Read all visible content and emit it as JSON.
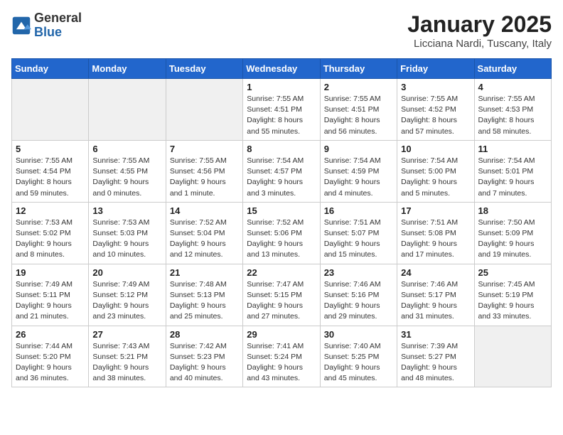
{
  "header": {
    "logo_general": "General",
    "logo_blue": "Blue",
    "month_title": "January 2025",
    "location": "Licciana Nardi, Tuscany, Italy"
  },
  "days_of_week": [
    "Sunday",
    "Monday",
    "Tuesday",
    "Wednesday",
    "Thursday",
    "Friday",
    "Saturday"
  ],
  "weeks": [
    [
      {
        "day": "",
        "info": ""
      },
      {
        "day": "",
        "info": ""
      },
      {
        "day": "",
        "info": ""
      },
      {
        "day": "1",
        "info": "Sunrise: 7:55 AM\nSunset: 4:51 PM\nDaylight: 8 hours\nand 55 minutes."
      },
      {
        "day": "2",
        "info": "Sunrise: 7:55 AM\nSunset: 4:51 PM\nDaylight: 8 hours\nand 56 minutes."
      },
      {
        "day": "3",
        "info": "Sunrise: 7:55 AM\nSunset: 4:52 PM\nDaylight: 8 hours\nand 57 minutes."
      },
      {
        "day": "4",
        "info": "Sunrise: 7:55 AM\nSunset: 4:53 PM\nDaylight: 8 hours\nand 58 minutes."
      }
    ],
    [
      {
        "day": "5",
        "info": "Sunrise: 7:55 AM\nSunset: 4:54 PM\nDaylight: 8 hours\nand 59 minutes."
      },
      {
        "day": "6",
        "info": "Sunrise: 7:55 AM\nSunset: 4:55 PM\nDaylight: 9 hours\nand 0 minutes."
      },
      {
        "day": "7",
        "info": "Sunrise: 7:55 AM\nSunset: 4:56 PM\nDaylight: 9 hours\nand 1 minute."
      },
      {
        "day": "8",
        "info": "Sunrise: 7:54 AM\nSunset: 4:57 PM\nDaylight: 9 hours\nand 3 minutes."
      },
      {
        "day": "9",
        "info": "Sunrise: 7:54 AM\nSunset: 4:59 PM\nDaylight: 9 hours\nand 4 minutes."
      },
      {
        "day": "10",
        "info": "Sunrise: 7:54 AM\nSunset: 5:00 PM\nDaylight: 9 hours\nand 5 minutes."
      },
      {
        "day": "11",
        "info": "Sunrise: 7:54 AM\nSunset: 5:01 PM\nDaylight: 9 hours\nand 7 minutes."
      }
    ],
    [
      {
        "day": "12",
        "info": "Sunrise: 7:53 AM\nSunset: 5:02 PM\nDaylight: 9 hours\nand 8 minutes."
      },
      {
        "day": "13",
        "info": "Sunrise: 7:53 AM\nSunset: 5:03 PM\nDaylight: 9 hours\nand 10 minutes."
      },
      {
        "day": "14",
        "info": "Sunrise: 7:52 AM\nSunset: 5:04 PM\nDaylight: 9 hours\nand 12 minutes."
      },
      {
        "day": "15",
        "info": "Sunrise: 7:52 AM\nSunset: 5:06 PM\nDaylight: 9 hours\nand 13 minutes."
      },
      {
        "day": "16",
        "info": "Sunrise: 7:51 AM\nSunset: 5:07 PM\nDaylight: 9 hours\nand 15 minutes."
      },
      {
        "day": "17",
        "info": "Sunrise: 7:51 AM\nSunset: 5:08 PM\nDaylight: 9 hours\nand 17 minutes."
      },
      {
        "day": "18",
        "info": "Sunrise: 7:50 AM\nSunset: 5:09 PM\nDaylight: 9 hours\nand 19 minutes."
      }
    ],
    [
      {
        "day": "19",
        "info": "Sunrise: 7:49 AM\nSunset: 5:11 PM\nDaylight: 9 hours\nand 21 minutes."
      },
      {
        "day": "20",
        "info": "Sunrise: 7:49 AM\nSunset: 5:12 PM\nDaylight: 9 hours\nand 23 minutes."
      },
      {
        "day": "21",
        "info": "Sunrise: 7:48 AM\nSunset: 5:13 PM\nDaylight: 9 hours\nand 25 minutes."
      },
      {
        "day": "22",
        "info": "Sunrise: 7:47 AM\nSunset: 5:15 PM\nDaylight: 9 hours\nand 27 minutes."
      },
      {
        "day": "23",
        "info": "Sunrise: 7:46 AM\nSunset: 5:16 PM\nDaylight: 9 hours\nand 29 minutes."
      },
      {
        "day": "24",
        "info": "Sunrise: 7:46 AM\nSunset: 5:17 PM\nDaylight: 9 hours\nand 31 minutes."
      },
      {
        "day": "25",
        "info": "Sunrise: 7:45 AM\nSunset: 5:19 PM\nDaylight: 9 hours\nand 33 minutes."
      }
    ],
    [
      {
        "day": "26",
        "info": "Sunrise: 7:44 AM\nSunset: 5:20 PM\nDaylight: 9 hours\nand 36 minutes."
      },
      {
        "day": "27",
        "info": "Sunrise: 7:43 AM\nSunset: 5:21 PM\nDaylight: 9 hours\nand 38 minutes."
      },
      {
        "day": "28",
        "info": "Sunrise: 7:42 AM\nSunset: 5:23 PM\nDaylight: 9 hours\nand 40 minutes."
      },
      {
        "day": "29",
        "info": "Sunrise: 7:41 AM\nSunset: 5:24 PM\nDaylight: 9 hours\nand 43 minutes."
      },
      {
        "day": "30",
        "info": "Sunrise: 7:40 AM\nSunset: 5:25 PM\nDaylight: 9 hours\nand 45 minutes."
      },
      {
        "day": "31",
        "info": "Sunrise: 7:39 AM\nSunset: 5:27 PM\nDaylight: 9 hours\nand 48 minutes."
      },
      {
        "day": "",
        "info": ""
      }
    ]
  ]
}
